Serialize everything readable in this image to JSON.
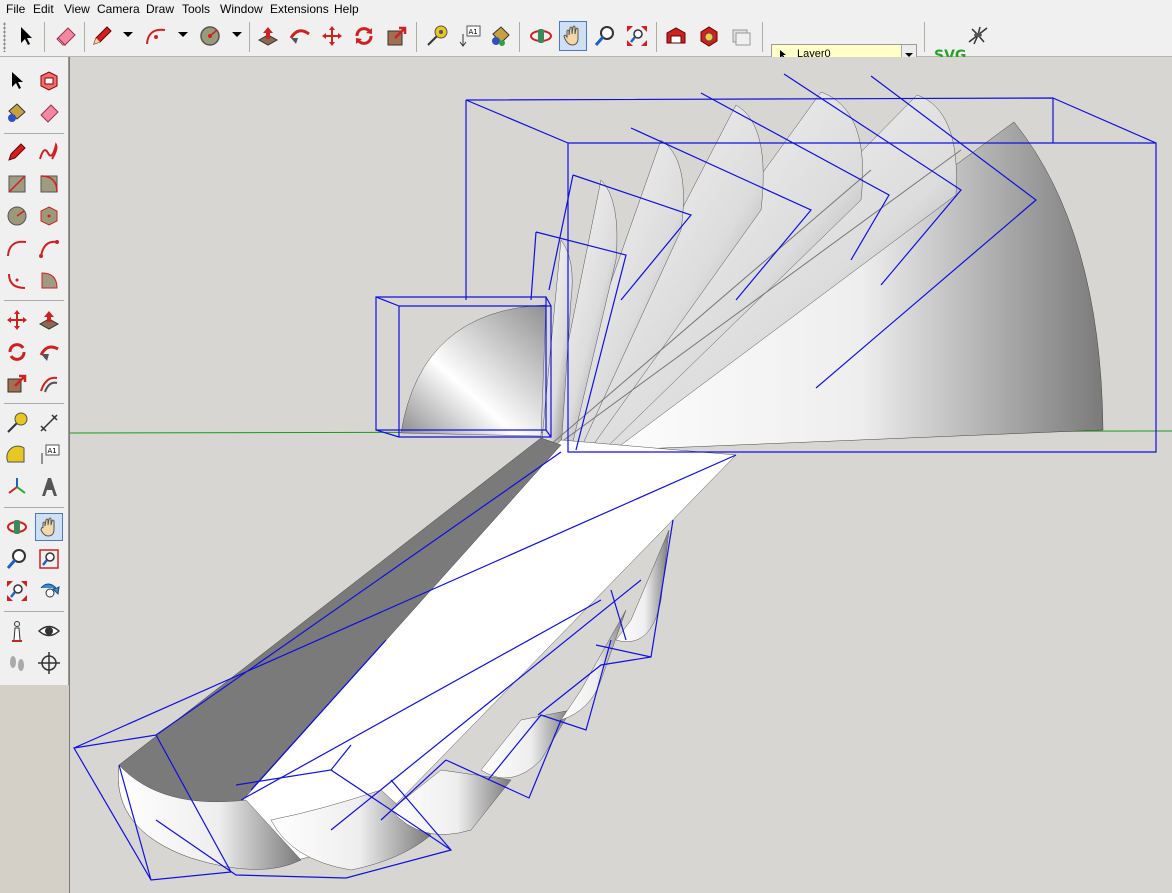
{
  "menu": [
    "File",
    "Edit",
    "View",
    "Camera",
    "Draw",
    "Tools",
    "Window",
    "Extensions",
    "Help"
  ],
  "toolbar": {
    "layer_value": "Layer0",
    "svg_label": "SVG",
    "tools": [
      "select-tool",
      "eraser-tool",
      "pencil-tool",
      "arc-tool",
      "circle-tool",
      "push-pull-tool",
      "follow-me-tool",
      "move-tool",
      "rotate-tool",
      "scale-tool",
      "tape-measure-tool",
      "text-tool",
      "paint-bucket-tool",
      "orbit-tool",
      "pan-tool",
      "zoom-tool",
      "zoom-extents-tool",
      "get-models-tool",
      "components-tool",
      "share-tool"
    ]
  },
  "left_toolbar": {
    "text_tool_label": "A1",
    "tools": [
      "select",
      "make-component",
      "paint-bucket",
      "eraser",
      "line",
      "freehand",
      "rectangle",
      "rotated-rectangle",
      "circle",
      "polygon",
      "arc",
      "2-point-arc",
      "3-point-arc",
      "pie",
      "move",
      "push-pull",
      "rotate",
      "follow-me",
      "scale",
      "offset",
      "tape-measure",
      "dimension",
      "protractor",
      "text",
      "axes",
      "3d-text",
      "orbit",
      "pan",
      "zoom",
      "zoom-window",
      "zoom-extents",
      "previous-view",
      "position-camera",
      "look-around",
      "walk",
      "section-plane"
    ]
  },
  "colors": {
    "bounding_box": "#1010dd",
    "axis_green": "#1a9a1a",
    "viewport_bg": "#d8d6d3",
    "accent_red": "#cc2020"
  }
}
